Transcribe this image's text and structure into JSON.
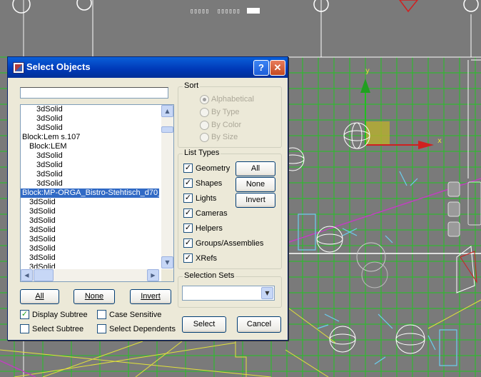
{
  "viewport": {
    "status_texts": [
      "▯▯▯▯▯",
      "▯▯▯▯▯▯"
    ],
    "axis_y_label": "y",
    "axis_x_label": "x",
    "grid_color": "#22c422",
    "line_color_yellow": "#e2e23a",
    "line_color_magenta": "#c040c0"
  },
  "dialog": {
    "title": "Select Objects",
    "help_icon": "question-icon",
    "close_icon": "close-x-icon",
    "name_input": {
      "value": "",
      "placeholder": ""
    },
    "list_items": [
      {
        "label": "3dSolid",
        "indent": 2,
        "selected": false
      },
      {
        "label": "3dSolid",
        "indent": 2,
        "selected": false
      },
      {
        "label": "3dSolid",
        "indent": 2,
        "selected": false
      },
      {
        "label": "Block:Lem s.107",
        "indent": 0,
        "selected": false
      },
      {
        "label": "Block:LEM",
        "indent": 1,
        "selected": false
      },
      {
        "label": "3dSolid",
        "indent": 2,
        "selected": false
      },
      {
        "label": "3dSolid",
        "indent": 2,
        "selected": false
      },
      {
        "label": "3dSolid",
        "indent": 2,
        "selected": false
      },
      {
        "label": "3dSolid",
        "indent": 2,
        "selected": false
      },
      {
        "label": "Block:MP-ORGA_Bistro-Stehtisch_d70_",
        "indent": 0,
        "selected": true
      },
      {
        "label": "3dSolid",
        "indent": 1,
        "selected": false
      },
      {
        "label": "3dSolid",
        "indent": 1,
        "selected": false
      },
      {
        "label": "3dSolid",
        "indent": 1,
        "selected": false
      },
      {
        "label": "3dSolid",
        "indent": 1,
        "selected": false
      },
      {
        "label": "3dSolid",
        "indent": 1,
        "selected": false
      },
      {
        "label": "3dSolid",
        "indent": 1,
        "selected": false
      },
      {
        "label": "3dSolid",
        "indent": 1,
        "selected": false
      },
      {
        "label": "3dSolid",
        "indent": 1,
        "selected": false
      }
    ],
    "bottom_buttons": {
      "all": "All",
      "none": "None",
      "invert": "Invert"
    },
    "options": {
      "display_subtree": {
        "label": "Display Subtree",
        "checked": true
      },
      "case_sensitive": {
        "label": "Case Sensitive",
        "checked": false
      },
      "select_subtree": {
        "label": "Select Subtree",
        "checked": false
      },
      "select_dependents": {
        "label": "Select Dependents",
        "checked": false
      }
    },
    "sort": {
      "label": "Sort",
      "options": [
        {
          "label": "Alphabetical",
          "selected": true
        },
        {
          "label": "By Type",
          "selected": false
        },
        {
          "label": "By Color",
          "selected": false
        },
        {
          "label": "By Size",
          "selected": false
        }
      ]
    },
    "list_types": {
      "label": "List Types",
      "items": [
        {
          "label": "Geometry",
          "checked": true
        },
        {
          "label": "Shapes",
          "checked": true
        },
        {
          "label": "Lights",
          "checked": true
        },
        {
          "label": "Cameras",
          "checked": true
        },
        {
          "label": "Helpers",
          "checked": true
        },
        {
          "label": "Groups/Assemblies",
          "checked": true
        },
        {
          "label": "XRefs",
          "checked": true
        }
      ],
      "buttons": {
        "all": "All",
        "none": "None",
        "invert": "Invert"
      }
    },
    "selection_sets": {
      "label": "Selection Sets",
      "value": ""
    },
    "select_button": "Select",
    "cancel_button": "Cancel"
  }
}
